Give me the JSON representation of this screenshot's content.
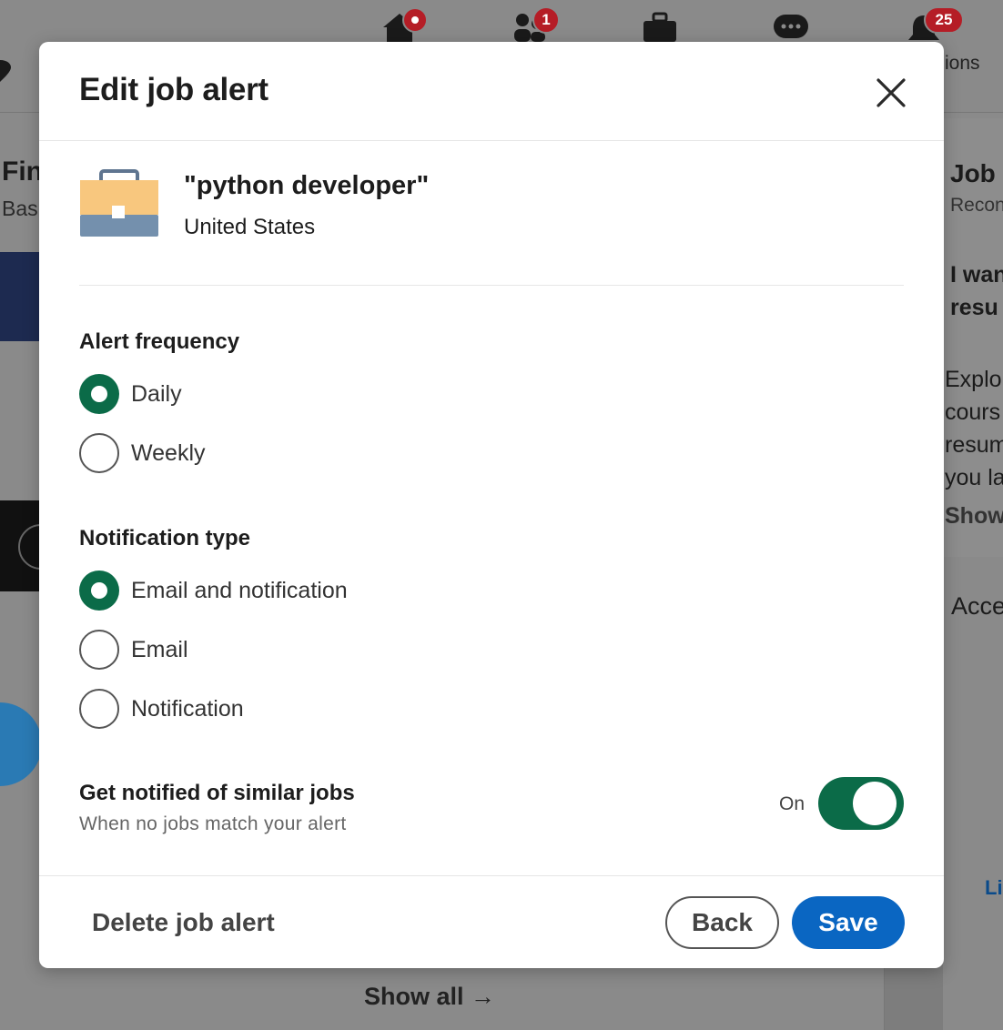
{
  "background": {
    "nav_badges": {
      "network": "1",
      "notifications": "25"
    },
    "nav_text": "ions",
    "left_text": {
      "heading": "Fin",
      "sub": "Bas"
    },
    "right_text": {
      "heading": "Job",
      "sub": "Recon",
      "promo_line1": "I wan",
      "promo_line2": "resu",
      "body_line1": "Explo",
      "body_line2": "cours",
      "body_line3": "resum",
      "body_line4": "you la",
      "show_link": "Show",
      "acce": "Acce",
      "li": "Li"
    },
    "show_all": "Show all →"
  },
  "modal": {
    "title": "Edit job alert",
    "job": {
      "keyword": "\"python developer\"",
      "location": "United States"
    },
    "frequency": {
      "label": "Alert frequency",
      "options": [
        {
          "label": "Daily",
          "checked": true
        },
        {
          "label": "Weekly",
          "checked": false
        }
      ]
    },
    "notification_type": {
      "label": "Notification type",
      "options": [
        {
          "label": "Email and notification",
          "checked": true
        },
        {
          "label": "Email",
          "checked": false
        },
        {
          "label": "Notification",
          "checked": false
        }
      ]
    },
    "similar_jobs": {
      "title": "Get notified of similar jobs",
      "subtitle": "When no jobs match your alert",
      "toggle_label": "On",
      "enabled": true
    },
    "footer": {
      "delete_label": "Delete job alert",
      "back_label": "Back",
      "save_label": "Save"
    }
  },
  "colors": {
    "accent_green": "#0b6b48",
    "primary_blue": "#0a66c2",
    "badge_red": "#b51d26"
  }
}
